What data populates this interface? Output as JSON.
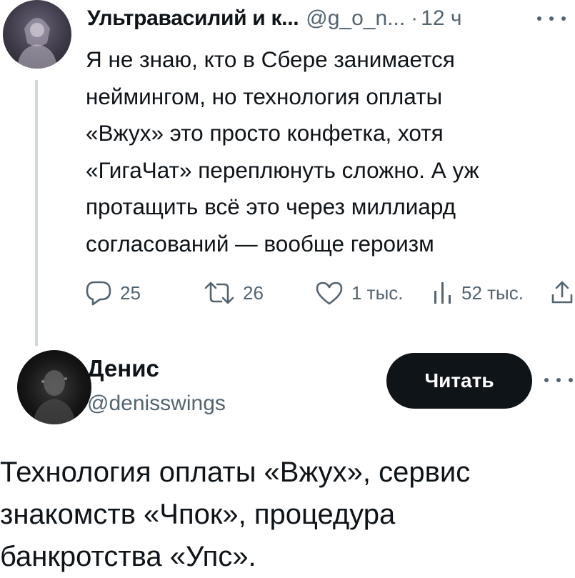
{
  "tweet1": {
    "author_name": "Ультравасилий и к...",
    "handle": "@g_o_n...",
    "separator": "·",
    "time": "12 ч",
    "text_lines": [
      "Я не знаю, кто в Сбере занимается",
      "неймингом, но технология оплаты",
      "«Вжух» это просто конфетка, хотя",
      "«ГигаЧат» переплюнуть сложно. А уж",
      "протащить всё это через миллиард",
      "согласований — вообще героизм"
    ],
    "actions": {
      "replies": "25",
      "retweets": "26",
      "likes": "1 тыс.",
      "views": "52 тыс."
    }
  },
  "tweet2": {
    "author_name": "Денис",
    "handle": "@denisswings",
    "follow_label": "Читать",
    "text_lines": [
      "Технология оплаты «Вжух», сервис",
      "знакомств «Чпок», процедура",
      "банкротства «Упс»."
    ]
  },
  "icons": {
    "reply": "reply-icon",
    "retweet": "retweet-icon",
    "like": "heart-icon",
    "views": "views-bar-chart-icon",
    "share": "share-icon",
    "more": "more-dots-icon"
  }
}
